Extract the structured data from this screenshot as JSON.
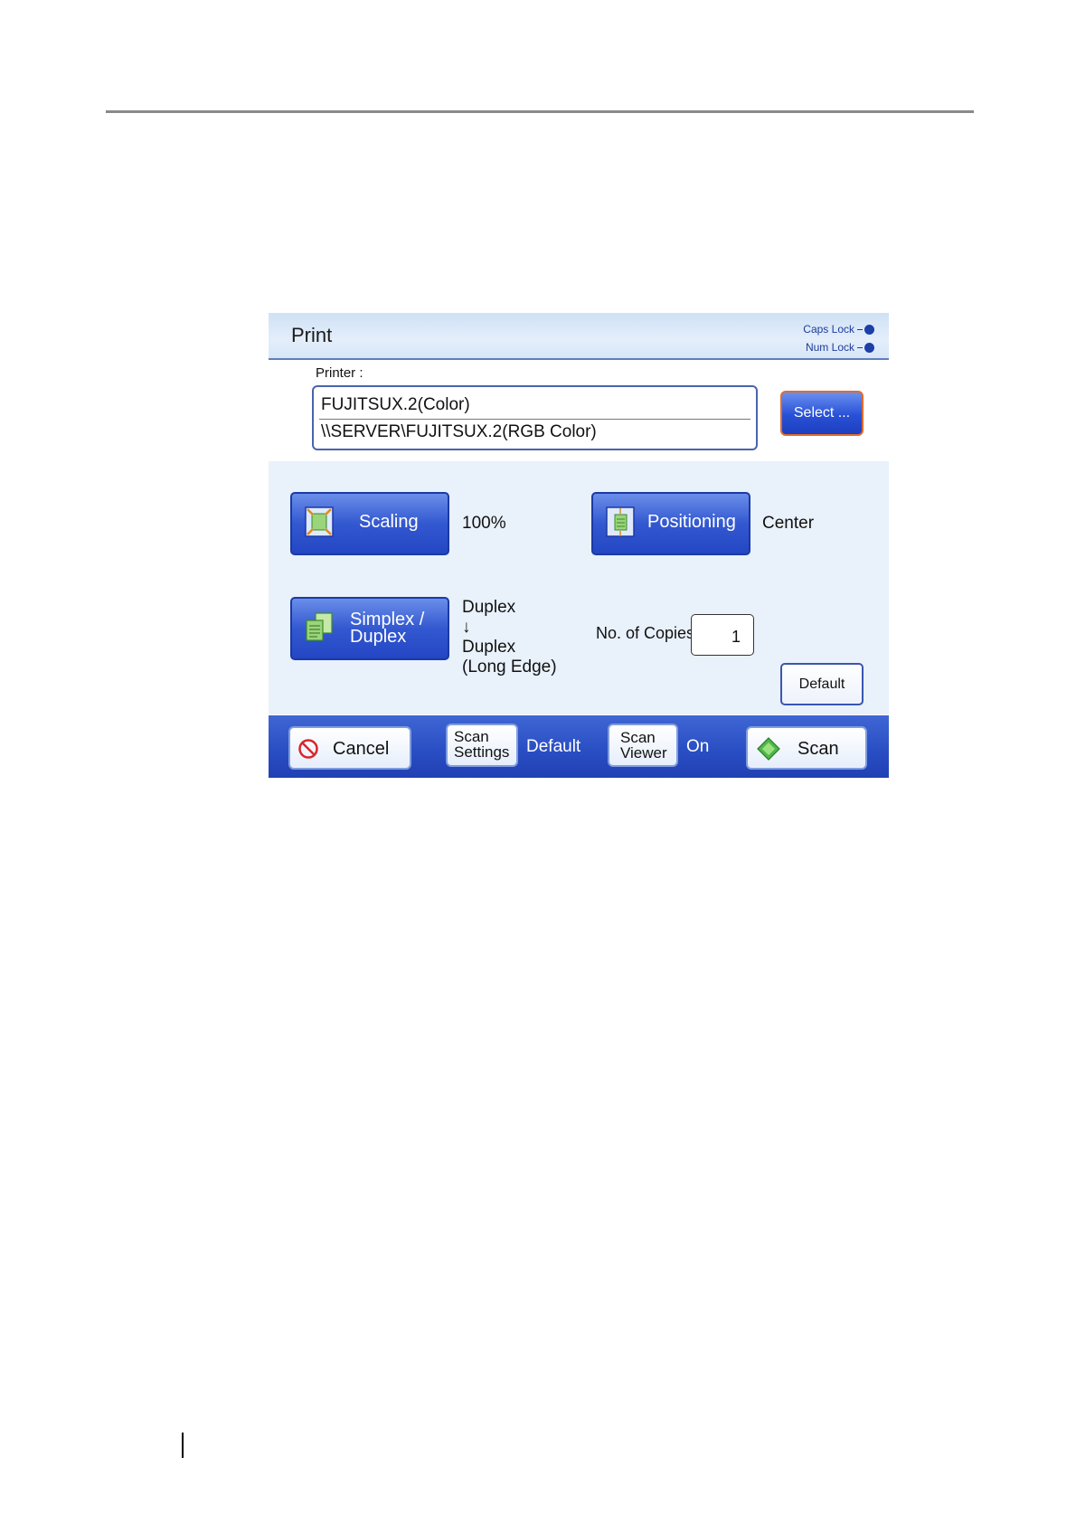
{
  "dialog": {
    "title": "Print",
    "indicators": {
      "caps_lock": "Caps Lock",
      "num_lock": "Num Lock"
    }
  },
  "printer": {
    "label": "Printer :",
    "name": "FUJITSUX.2(Color)",
    "path": "\\\\SERVER\\FUJITSUX.2(RGB Color)",
    "select_label": "Select ..."
  },
  "settings": {
    "scaling_label": "Scaling",
    "scaling_value": "100%",
    "positioning_label": "Positioning",
    "positioning_value": "Center",
    "simplex_label_1": "Simplex /",
    "simplex_label_2": "Duplex",
    "duplex_value_1": "Duplex",
    "duplex_arrow": "↓",
    "duplex_value_2": "Duplex",
    "duplex_value_3": "(Long Edge)",
    "copies_label": "No. of Copies",
    "copies_value": "1",
    "default_label": "Default"
  },
  "footer": {
    "cancel_label": "Cancel",
    "scan_settings_1": "Scan",
    "scan_settings_2": "Settings",
    "scan_settings_value": "Default",
    "scan_viewer_1": "Scan",
    "scan_viewer_2": "Viewer",
    "scan_viewer_value": "On",
    "scan_label": "Scan"
  },
  "icons": {
    "scaling": "scaling-icon",
    "positioning": "positioning-icon",
    "simplex": "duplex-pages-icon",
    "cancel": "prohibited-icon",
    "scan": "green-diamond-icon"
  },
  "colors": {
    "button_blue": "#2f52cc",
    "select_border": "#e06b2e",
    "panel_bg": "#e9f1fb",
    "footer_blue": "#2a4fc4"
  }
}
